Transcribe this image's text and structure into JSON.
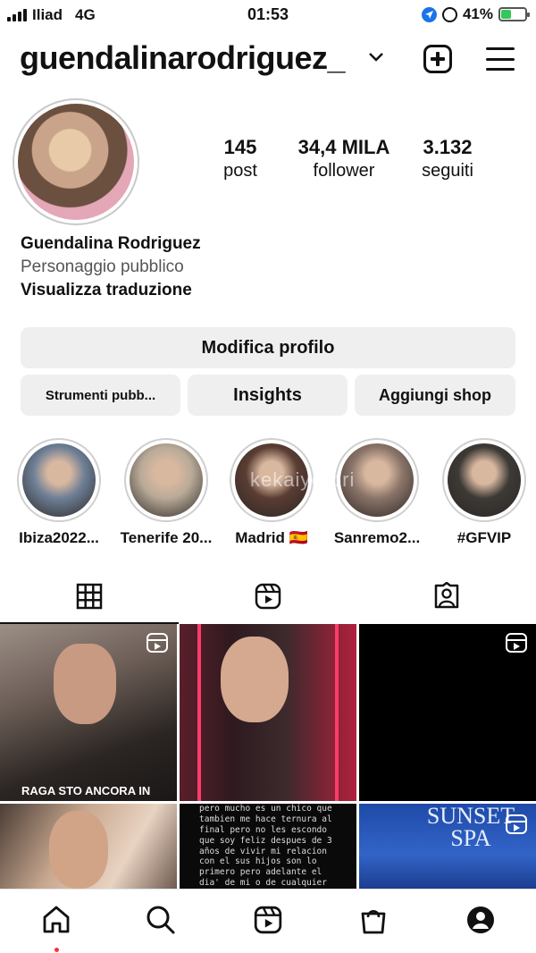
{
  "status_bar": {
    "carrier": "Iliad",
    "network": "4G",
    "time": "01:53",
    "battery_percent": "41%",
    "battery_level": 0.41,
    "icons": [
      "signal-icon",
      "location-icon",
      "rotation-lock-icon",
      "battery-charging-icon"
    ]
  },
  "header": {
    "username": "guendalinarodriguez_",
    "icons": [
      "chevron-down-icon",
      "new-post-icon",
      "menu-icon"
    ]
  },
  "profile": {
    "stats": [
      {
        "value": "145",
        "label": "post"
      },
      {
        "value": "34,4 MILA",
        "label": "follower"
      },
      {
        "value": "3.132",
        "label": "seguiti"
      }
    ],
    "name": "Guendalina Rodriguez",
    "category": "Personaggio pubblico",
    "translate_link": "Visualizza traduzione"
  },
  "buttons": {
    "edit_profile": "Modifica profilo",
    "tools": "Strumenti pubb...",
    "insights": "Insights",
    "add_shop": "Aggiungi shop"
  },
  "highlights": [
    {
      "label": "Ibiza2022...",
      "color": "#6e7f96"
    },
    {
      "label": "Tenerife 20...",
      "color": "#b9aa98"
    },
    {
      "label": "Madrid 🇪🇸",
      "color": "#5a3d33"
    },
    {
      "label": "Sanremo2...",
      "color": "#8a7468"
    },
    {
      "label": "#GFVIP",
      "color": "#3d3a36"
    }
  ],
  "watermark": "kekaiyorbri",
  "tabs": [
    {
      "icon": "grid-icon",
      "active": true
    },
    {
      "icon": "reels-icon",
      "active": false
    },
    {
      "icon": "tagged-icon",
      "active": false
    }
  ],
  "posts": {
    "caption_1": "RAGA STO ANCORA IN",
    "text_post": "pero mucho es un chico que tambien me hace ternura al final pero no les escondo que soy feliz despues de 3 años de vivir mi relacion con el sus hijos son lo primero pero adelante el dia' de mi o de cualquier persona le toca vivir y respirar su vida y espero",
    "spa_text": "SUNSET SPA"
  },
  "nav": {
    "icons": [
      "home-icon",
      "search-icon",
      "reels-icon",
      "shop-icon",
      "profile-icon"
    ]
  },
  "colors": {
    "button_bg": "#efefef",
    "notification_dot": "#ff3040",
    "battery_green": "#34c759",
    "location_blue": "#1a73e8"
  }
}
